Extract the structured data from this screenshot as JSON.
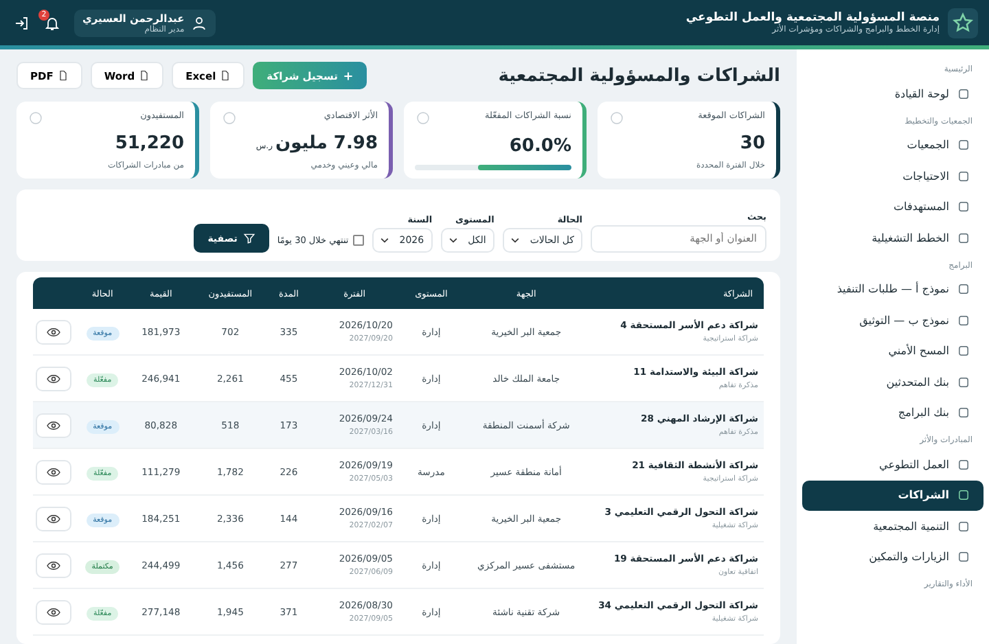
{
  "header": {
    "title": "منصة المسؤولية المجتمعية والعمل التطوعي",
    "subtitle": "إدارة الخطط والبرامج والشراكات ومؤشرات الأثر",
    "user": {
      "name": "عبدالرحمن العسيري",
      "role": "مدير النظام"
    },
    "notifications": "2"
  },
  "sidebar": {
    "sections": [
      {
        "title": "الرئيسية",
        "items": [
          {
            "label": "لوحة القيادة",
            "selected": false
          }
        ]
      },
      {
        "title": "الجمعيات والتخطيط",
        "items": [
          {
            "label": "الجمعيات",
            "selected": false
          },
          {
            "label": "الاحتياجات",
            "selected": false
          },
          {
            "label": "المستهدفات",
            "selected": false
          },
          {
            "label": "الخطط التشغيلية",
            "selected": false
          }
        ]
      },
      {
        "title": "البرامج",
        "items": [
          {
            "label": "نموذج أ — طلبات التنفيذ",
            "selected": false
          },
          {
            "label": "نموذج ب — التوثيق",
            "selected": false
          },
          {
            "label": "المسح الأمني",
            "selected": false
          },
          {
            "label": "بنك المتحدثين",
            "selected": false
          },
          {
            "label": "بنك البرامج",
            "selected": false
          }
        ]
      },
      {
        "title": "المبادرات والأثر",
        "items": [
          {
            "label": "العمل التطوعي",
            "selected": false
          },
          {
            "label": "الشراكات",
            "selected": true
          },
          {
            "label": "التنمية المجتمعية",
            "selected": false
          },
          {
            "label": "الزيارات والتمكين",
            "selected": false
          }
        ]
      },
      {
        "title": "الأداء والتقارير"
      }
    ]
  },
  "page": {
    "title": "الشراكات والمسؤولية المجتمعية",
    "primary_action": "تسجيل شراكة",
    "exports": [
      "Excel",
      "Word",
      "PDF"
    ]
  },
  "stats": [
    {
      "label": "الشراكات الموقعة",
      "value": "30",
      "note": "خلال الفترة المحددة",
      "color": "#0f3a48"
    },
    {
      "label": "نسبة الشراكات المفعّلة",
      "value": "60.0%",
      "level": 0.6,
      "color": "#3fae7a"
    },
    {
      "label": "الأثر الاقتصادي",
      "value": "7.98 مليون",
      "unit": "ر.س",
      "note": "مالي وعيني وخدمي",
      "color": "#7a5fb0"
    },
    {
      "label": "المستفيدون",
      "value": "51,220",
      "note": "من مبادرات الشراكات",
      "color": "#2a8fa0"
    }
  ],
  "filters": {
    "search": {
      "label": "بحث",
      "placeholder": "العنوان أو الجهة"
    },
    "status": {
      "label": "الحالة",
      "value": "كل الحالات"
    },
    "level": {
      "label": "المستوى",
      "value": "الكل"
    },
    "year": {
      "label": "السنة",
      "value": "2026"
    },
    "expiring": {
      "label": "تنتهي خلال 30 يومًا",
      "checked": false
    },
    "button": "تصفية"
  },
  "table": {
    "columns": [
      "الشراكة",
      "الجهة",
      "المستوى",
      "الفترة",
      "المدة",
      "المستفيدون",
      "القيمة",
      "الحالة"
    ],
    "rows": [
      {
        "title": "شراكة دعم الأسر المستحقة 4",
        "type": "شراكة استراتيجية",
        "entity": "جمعية البر الخيرية",
        "level": "إدارة",
        "start": "2026/10/20",
        "end": "2027/09/20",
        "duration": "335",
        "beneficiaries": "702",
        "value": "181,973",
        "status": "موقعة",
        "kind": "signed",
        "selected": false
      },
      {
        "title": "شراكة البيئة والاستدامة 11",
        "type": "مذكرة تفاهم",
        "entity": "جامعة الملك خالد",
        "level": "إدارة",
        "start": "2026/10/02",
        "end": "2027/12/31",
        "duration": "455",
        "beneficiaries": "2,261",
        "value": "246,941",
        "status": "مفعّلة",
        "kind": "active",
        "selected": false
      },
      {
        "title": "شراكة الإرشاد المهني 28",
        "type": "مذكرة تفاهم",
        "entity": "شركة أسمنت المنطقة",
        "level": "إدارة",
        "start": "2026/09/24",
        "end": "2027/03/16",
        "duration": "173",
        "beneficiaries": "518",
        "value": "80,828",
        "status": "موقعة",
        "kind": "signed",
        "selected": true
      },
      {
        "title": "شراكة الأنشطة الثقافية 21",
        "type": "شراكة استراتيجية",
        "entity": "أمانة منطقة عسير",
        "level": "مدرسة",
        "start": "2026/09/19",
        "end": "2027/05/03",
        "duration": "226",
        "beneficiaries": "1,782",
        "value": "111,279",
        "status": "مفعّلة",
        "kind": "active",
        "selected": false
      },
      {
        "title": "شراكة التحول الرقمي التعليمي 3",
        "type": "شراكة تشغيلية",
        "entity": "جمعية البر الخيرية",
        "level": "إدارة",
        "start": "2026/09/16",
        "end": "2027/02/07",
        "duration": "144",
        "beneficiaries": "2,336",
        "value": "184,251",
        "status": "موقعة",
        "kind": "signed",
        "selected": false
      },
      {
        "title": "شراكة دعم الأسر المستحقة 19",
        "type": "اتفاقية تعاون",
        "entity": "مستشفى عسير المركزي",
        "level": "إدارة",
        "start": "2026/09/05",
        "end": "2027/06/09",
        "duration": "277",
        "beneficiaries": "1,456",
        "value": "244,499",
        "status": "مكتملة",
        "kind": "completed",
        "selected": false
      },
      {
        "title": "شراكة التحول الرقمي التعليمي 34",
        "type": "شراكة تشغيلية",
        "entity": "شركة تقنية ناشئة",
        "level": "إدارة",
        "start": "2026/08/30",
        "end": "2027/09/05",
        "duration": "371",
        "beneficiaries": "1,945",
        "value": "277,148",
        "status": "مفعّلة",
        "kind": "active",
        "selected": false
      }
    ]
  }
}
